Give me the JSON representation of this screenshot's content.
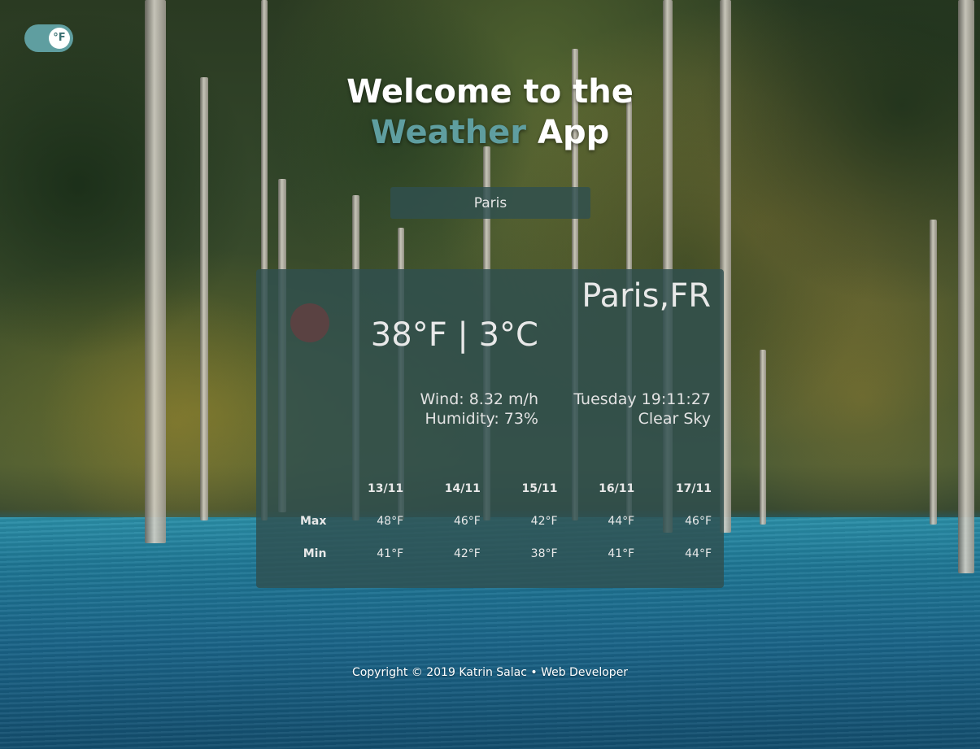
{
  "toggle": {
    "unit_label": "°F"
  },
  "heading": {
    "line1": "Welcome to the",
    "accent": "Weather",
    "rest": "App"
  },
  "search": {
    "value": "Paris"
  },
  "weather": {
    "city": "Paris,FR",
    "temperature": "38°F | 3°C",
    "wind": "Wind: 8.32 m/h",
    "humidity": "Humidity: 73%",
    "datetime": "Tuesday 19:11:27",
    "description": "Clear Sky"
  },
  "forecast": {
    "row_labels": {
      "max": "Max",
      "min": "Min"
    },
    "days": [
      {
        "date": "13/11",
        "max": "48°F",
        "min": "41°F"
      },
      {
        "date": "14/11",
        "max": "46°F",
        "min": "42°F"
      },
      {
        "date": "15/11",
        "max": "42°F",
        "min": "38°F"
      },
      {
        "date": "16/11",
        "max": "44°F",
        "min": "41°F"
      },
      {
        "date": "17/11",
        "max": "46°F",
        "min": "44°F"
      }
    ]
  },
  "footer": {
    "text": "Copyright © 2019 Katrin Salac • Web Developer"
  },
  "colors": {
    "accent": "#5f9ea0",
    "panel": "#2f4f4f",
    "icon_placeholder": "#5a4242"
  }
}
